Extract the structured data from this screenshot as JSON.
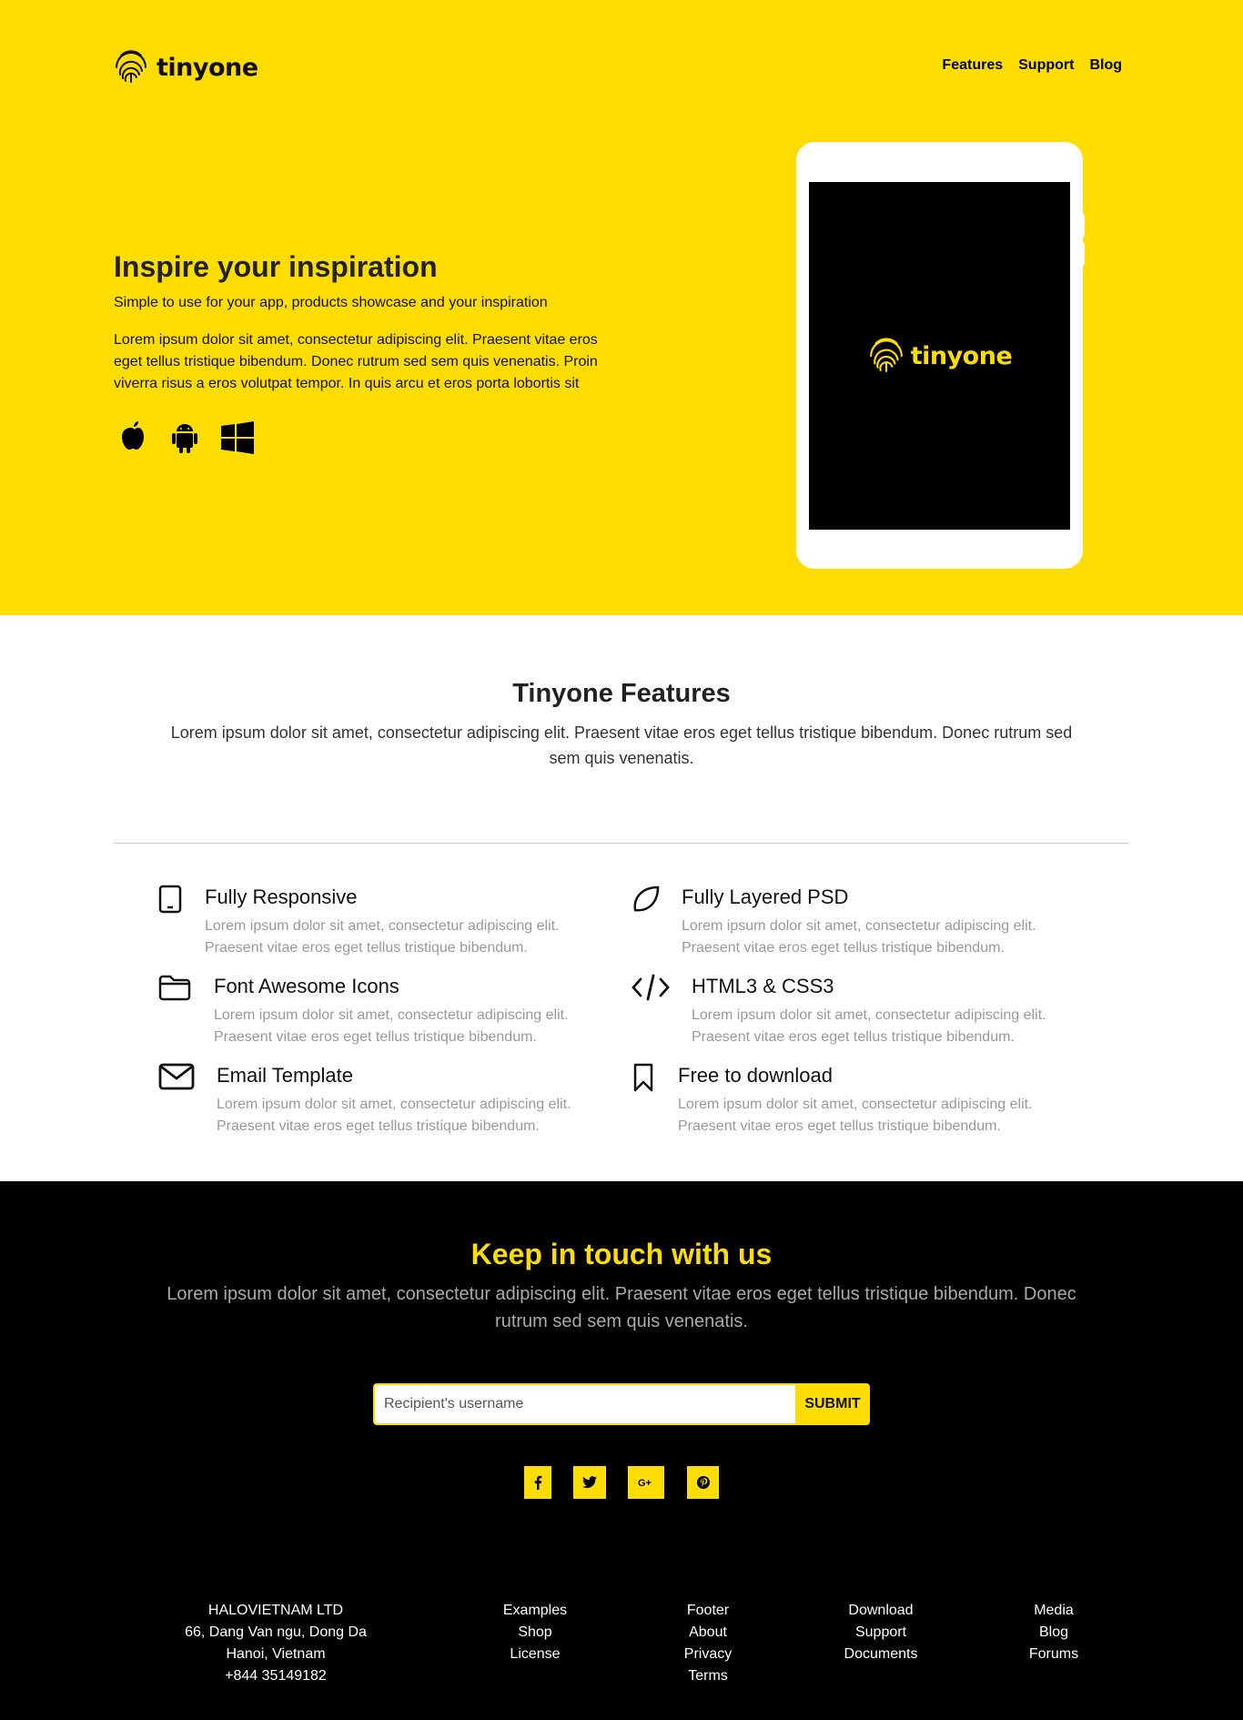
{
  "header": {
    "brand": "tinyone",
    "nav": [
      "Features",
      "Support",
      "Blog"
    ]
  },
  "hero": {
    "title": "Inspire your inspiration",
    "subtitle": "Simple to use for your app, products showcase and your inspiration",
    "body": "Lorem ipsum dolor sit amet, consectetur adipiscing elit. Praesent vitae eros eget tellus tristique bibendum. Donec rutrum sed sem quis venenatis. Proin viverra risus a eros volutpat tempor. In quis arcu et eros porta lobortis sit",
    "platforms": [
      "apple-icon",
      "android-icon",
      "windows-icon"
    ],
    "device_brand": "tinyone"
  },
  "features": {
    "title": "Tinyone Features",
    "intro": "Lorem ipsum dolor sit amet, consectetur adipiscing elit. Praesent vitae eros eget tellus tristique bibendum. Donec rutrum sed sem quis venenatis.",
    "items": [
      {
        "title": "Fully Responsive",
        "desc": "Lorem ipsum dolor sit amet, consectetur adipiscing elit. Praesent vitae eros eget tellus tristique bibendum.",
        "icon": "tablet-icon"
      },
      {
        "title": "Fully Layered PSD",
        "desc": "Lorem ipsum dolor sit amet, consectetur adipiscing elit. Praesent vitae eros eget tellus tristique bibendum.",
        "icon": "leaf-icon"
      },
      {
        "title": "Font Awesome Icons",
        "desc": "Lorem ipsum dolor sit amet, consectetur adipiscing elit. Praesent vitae eros eget tellus tristique bibendum.",
        "icon": "folder-icon"
      },
      {
        "title": "HTML3 & CSS3",
        "desc": "Lorem ipsum dolor sit amet, consectetur adipiscing elit. Praesent vitae eros eget tellus tristique bibendum.",
        "icon": "code-icon"
      },
      {
        "title": "Email Template",
        "desc": "Lorem ipsum dolor sit amet, consectetur adipiscing elit. Praesent vitae eros eget tellus tristique bibendum.",
        "icon": "envelope-icon"
      },
      {
        "title": "Free to download",
        "desc": "Lorem ipsum dolor sit amet, consectetur adipiscing elit. Praesent vitae eros eget tellus tristique bibendum.",
        "icon": "bookmark-icon"
      }
    ]
  },
  "contact": {
    "title": "Keep in touch with us",
    "text": "Lorem ipsum dolor sit amet, consectetur adipiscing elit. Praesent vitae eros eget tellus tristique bibendum. Donec rutrum sed sem quis venenatis.",
    "input_placeholder": "Recipient's username",
    "submit_label": "SUBMIT",
    "socials": [
      {
        "icon": "facebook-icon",
        "label": "f"
      },
      {
        "icon": "twitter-icon",
        "label": ""
      },
      {
        "icon": "google-plus-icon",
        "label": "G+"
      },
      {
        "icon": "pinterest-icon",
        "label": "P"
      }
    ]
  },
  "footer": {
    "company": [
      "HALOVIETNAM LTD",
      "66, Dang Van ngu, Dong Da",
      "Hanoi, Vietnam",
      "+844 35149182"
    ],
    "col1": [
      "Examples",
      "Shop",
      "License"
    ],
    "col2": [
      "Footer",
      "About",
      "Privacy",
      "Terms"
    ],
    "col3": [
      "Download",
      "Support",
      "Documents"
    ],
    "col4": [
      "Media",
      "Blog",
      "Forums"
    ]
  },
  "colors": {
    "accent": "#ffdd00",
    "dark": "#000000",
    "text": "#222222",
    "muted": "#999999"
  }
}
